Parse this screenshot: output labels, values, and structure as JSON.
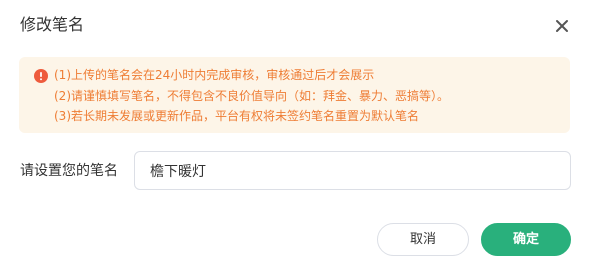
{
  "dialog": {
    "title": "修改笔名",
    "close_icon": "close-icon"
  },
  "notice": {
    "icon": "warning-circle-icon",
    "accent_color": "#ee7d35",
    "background": "#fdf5e8",
    "lines": [
      "(1)上传的笔名会在24小时内完成审核，审核通过后才会展示",
      "(2)请谨慎填写笔名，不得包含不良价值导向（如：拜金、暴力、恶搞等）。",
      "(3)若长期未发展或更新作品，平台有权将未签约笔名重置为默认笔名"
    ]
  },
  "form": {
    "label": "请设置您的笔名",
    "value": "檐下暖灯"
  },
  "actions": {
    "cancel_label": "取消",
    "ok_label": "确定",
    "ok_color": "#29b07c"
  }
}
